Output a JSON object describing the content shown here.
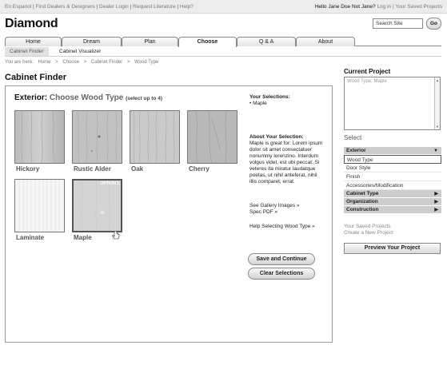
{
  "topbar": {
    "links": [
      "En Espanol",
      "Find Dealers & Designers",
      "Dealer Login",
      "Request Literature",
      "Help?"
    ],
    "greeting": "Hello Jane Doe",
    "not_user": "Not Jane?",
    "login": "Log in",
    "saved": "Your Saved Projects"
  },
  "header": {
    "logo": "Diamond",
    "search_value": "Search Site",
    "go_label": "Go"
  },
  "tabs": [
    "Home",
    "Dream",
    "Plan",
    "Choose",
    "Q & A",
    "About"
  ],
  "subnav": [
    "Cabinet Finder",
    "Cabinet Visualizer"
  ],
  "breadcrumb": [
    "You are here:",
    "Home",
    ">",
    "Choose",
    ">",
    "Cabinet Finder",
    ">",
    "Wood Type"
  ],
  "page_title": "Cabinet Finder",
  "main": {
    "heading_prefix": "Exterior:",
    "heading_main": "Choose Wood Type",
    "heading_note": "(select up to 4)",
    "swatches": [
      {
        "label": "Hickory"
      },
      {
        "label": "Rustic Alder"
      },
      {
        "label": "Oak"
      },
      {
        "label": "Cherry"
      },
      {
        "label": "Laminate"
      },
      {
        "label": "Maple",
        "badge": "OPTION 1"
      }
    ],
    "selections_title": "Your Selections:",
    "selections": [
      "Maple"
    ],
    "about_title": "About Your Selection:",
    "about_text": "Maple is great for: Lorem ipsum dolor sit amet consectatuer nonummy lorenzino. Interdum volgus videt, est ubi peccat. Si veteres ita miratur laudatque poetas, ut nihil anteferat, nihil illis comparet, errat.",
    "gallery_link": "See Gallery Images »",
    "spec_link": "Spec PDF »",
    "help_link": "Help Selecting Wood Type »",
    "save_btn": "Save and Continue",
    "clear_btn": "Clear Selections"
  },
  "sidebar": {
    "current_project": "Current Project",
    "project_entry": "Wood Type: Maple",
    "select_title": "Select",
    "exterior": "Exterior",
    "exterior_items": [
      "Wood Type",
      "Door Style",
      "Finish",
      "Accessories/Modification"
    ],
    "other_sections": [
      "Cabinet Type",
      "Organization",
      "Construction"
    ],
    "saved_link": "Your Saved Projects",
    "create_link": "Create a New Project",
    "preview_btn": "Preview Your Project"
  }
}
